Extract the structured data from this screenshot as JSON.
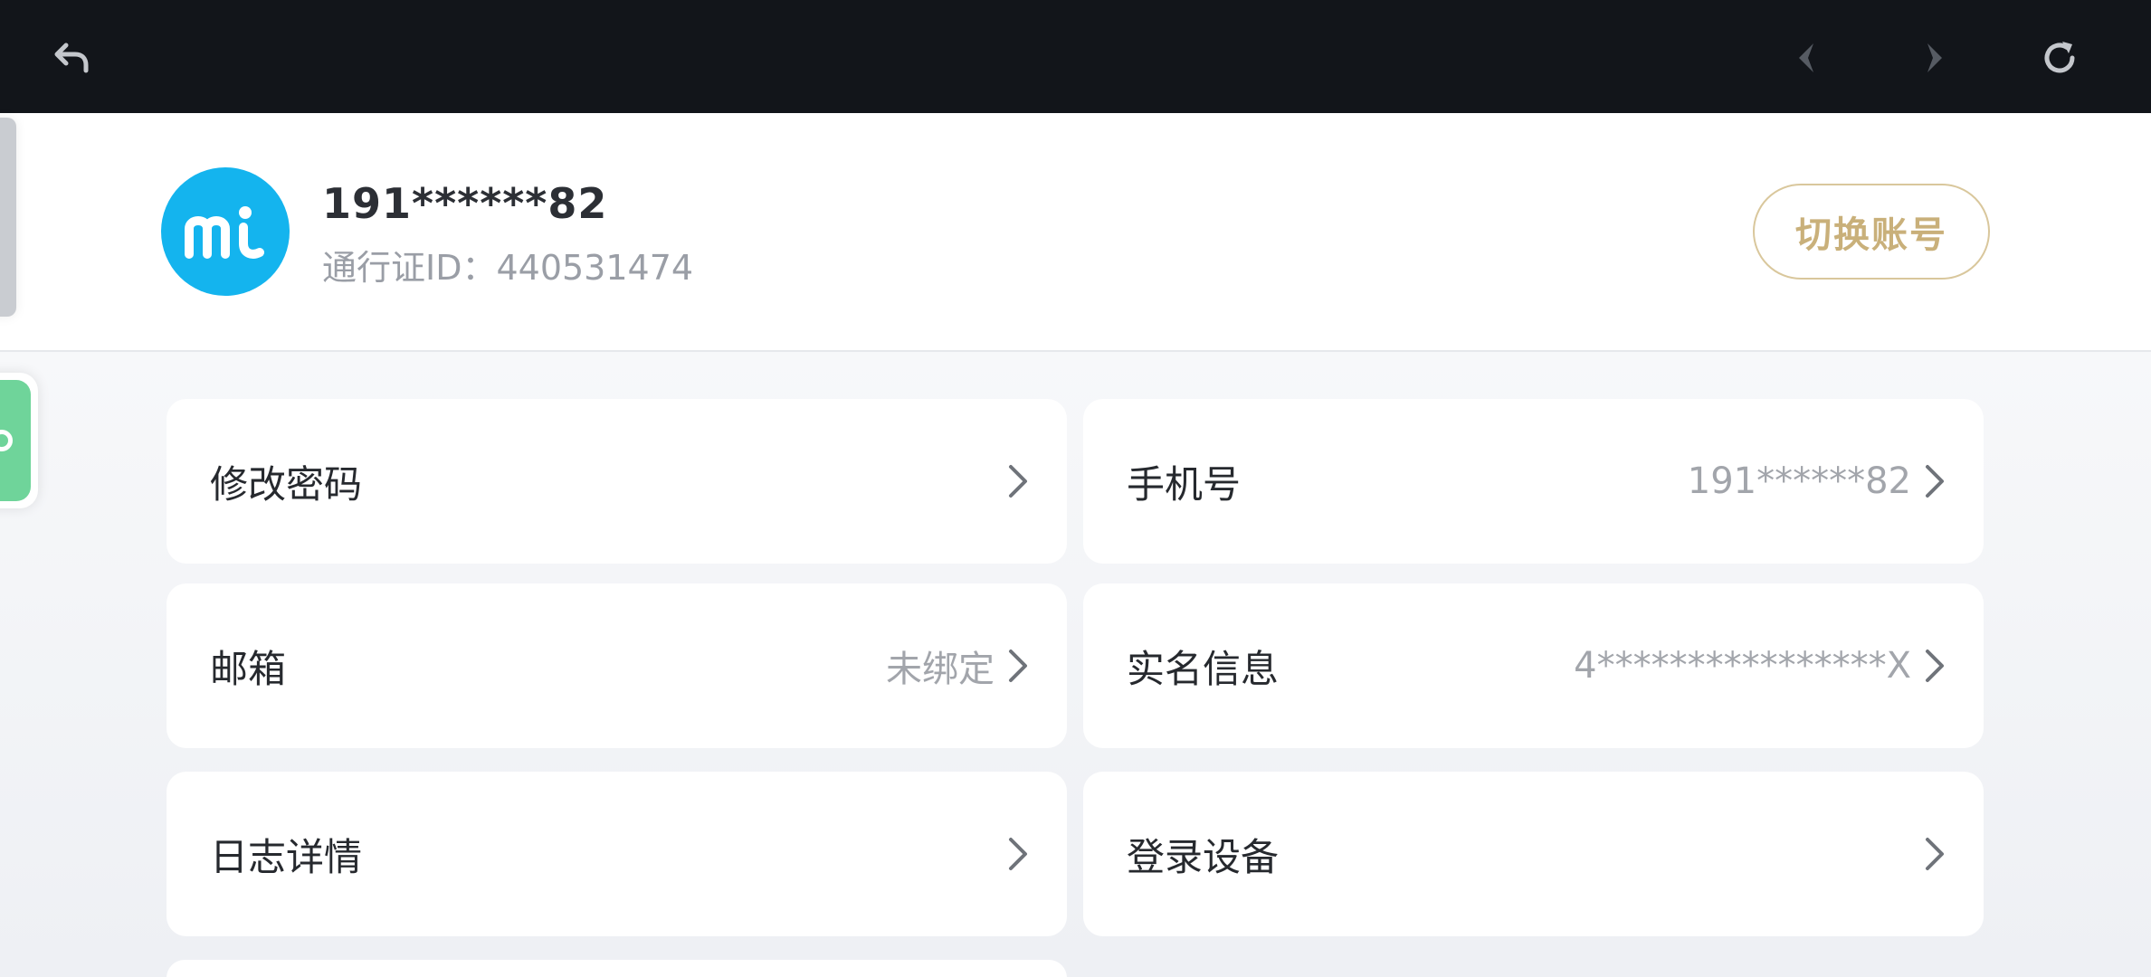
{
  "topbar": {
    "back_icon": "undo-arrow-icon",
    "prev_icon": "chevron-left-icon",
    "next_icon": "chevron-right-icon",
    "refresh_icon": "refresh-icon"
  },
  "profile": {
    "avatar_text": "mi",
    "avatar_color": "#14b4ee",
    "username": "191******82",
    "pass_id_label": "通行证ID：",
    "pass_id_value": "440531474",
    "switch_account_label": "切换账号"
  },
  "settings": [
    {
      "label": "修改密码",
      "value": ""
    },
    {
      "label": "手机号",
      "value": "191******82"
    },
    {
      "label": "邮箱",
      "value": "未绑定"
    },
    {
      "label": "实名信息",
      "value": "4****************X"
    },
    {
      "label": "日志详情",
      "value": ""
    },
    {
      "label": "登录设备",
      "value": ""
    }
  ],
  "colors": {
    "topbar_bg": "#12151a",
    "accent_gold": "#c9b07a",
    "brand_blue": "#14b4ee"
  }
}
